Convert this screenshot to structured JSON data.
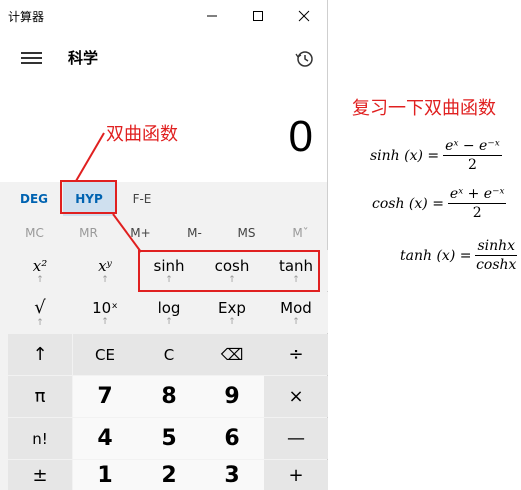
{
  "window": {
    "title": "计算器",
    "mode": "科学",
    "display_value": "0"
  },
  "angle_toggles": [
    "DEG",
    "HYP",
    "F-E"
  ],
  "memory_buttons": [
    "MC",
    "MR",
    "M+",
    "M-",
    "MS",
    "Mˇ"
  ],
  "keys": {
    "x_squared": "x²",
    "x_power_y": "xʸ",
    "sinh": "sinh",
    "cosh": "cosh",
    "tanh": "tanh",
    "sub_arrow": "↑",
    "sqrt": "√",
    "ten_pow_x": "10ˣ",
    "log": "log",
    "exp": "Exp",
    "mod": "Mod",
    "shift": "↑",
    "ce": "CE",
    "c": "C",
    "backspace": "⌫",
    "divide": "÷",
    "pi": "π",
    "seven": "7",
    "eight": "8",
    "nine": "9",
    "multiply": "×",
    "factorial": "n!",
    "four": "4",
    "five": "5",
    "six": "6",
    "minus": "—",
    "plus_minus": "±",
    "one": "1",
    "two": "2",
    "three": "3",
    "plus": "+"
  },
  "annotations": {
    "left_label": "双曲函数",
    "right_title": "复习一下双曲函数",
    "sinh_lhs": "sinh (x) =",
    "sinh_num": "eˣ − e⁻ˣ",
    "sinh_den": "2",
    "cosh_lhs": "cosh (x) =",
    "cosh_num": "eˣ + e⁻ˣ",
    "cosh_den": "2",
    "tanh_lhs": "tanh (x) =",
    "tanh_num": "sinhx",
    "tanh_den": "coshx"
  },
  "colors": {
    "accent_blue": "#0063b1",
    "annotation_red": "#e02020",
    "hyp_highlight": "#cfe0ef"
  }
}
